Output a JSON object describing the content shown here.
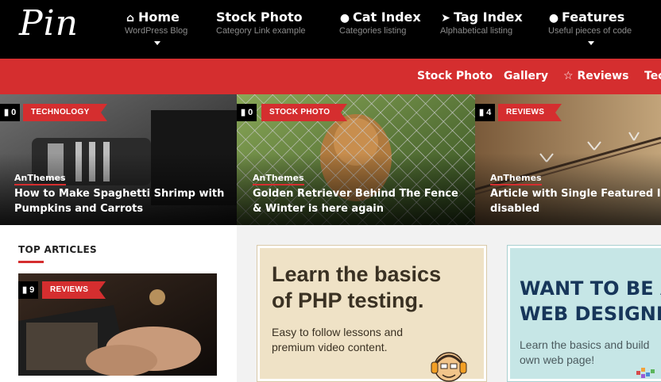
{
  "header": {
    "logo": "Pin",
    "nav": [
      {
        "title": "Home",
        "subtitle": "WordPress Blog",
        "icon": "home-icon"
      },
      {
        "title": "Stock Photo",
        "subtitle": "Category Link example",
        "icon": ""
      },
      {
        "title": "Cat Index",
        "subtitle": "Categories listing",
        "icon": "globe-icon"
      },
      {
        "title": "Tag Index",
        "subtitle": "Alphabetical listing",
        "icon": "rocket-icon"
      },
      {
        "title": "Features",
        "subtitle": "Useful pieces of code",
        "icon": "bomb-icon"
      }
    ]
  },
  "secondary_nav": [
    "Stock Photo",
    "Gallery",
    "Reviews",
    "Tec"
  ],
  "slider": [
    {
      "comments": "0",
      "category": "TECHNOLOGY",
      "author": "AnThemes",
      "title": "How to Make Spaghetti Shrimp with Pumpkins and Carrots"
    },
    {
      "comments": "0",
      "category": "STOCK PHOTO",
      "author": "AnThemes",
      "title": "Golden Retriever Behind The Fence & Winter is here again"
    },
    {
      "comments": "4",
      "category": "REVIEWS",
      "author": "AnThemes",
      "title": "Article with Single Featured Image disabled"
    }
  ],
  "sidebar": {
    "heading": "TOP ARTICLES",
    "item": {
      "comments": "9",
      "category": "REVIEWS"
    }
  },
  "ads": {
    "php": {
      "heading_line1": "Learn the basics",
      "heading_line2": "of PHP testing.",
      "body_line1": "Easy to follow lessons and",
      "body_line2": "premium video content."
    },
    "designer": {
      "heading_line1": "WANT TO BE A",
      "heading_line2": "WEB DESIGNER?",
      "body_line1": "Learn the basics and build",
      "body_line2": "own web page!"
    }
  },
  "colors": {
    "accent": "#d52e2f",
    "header_bg": "#000000"
  }
}
